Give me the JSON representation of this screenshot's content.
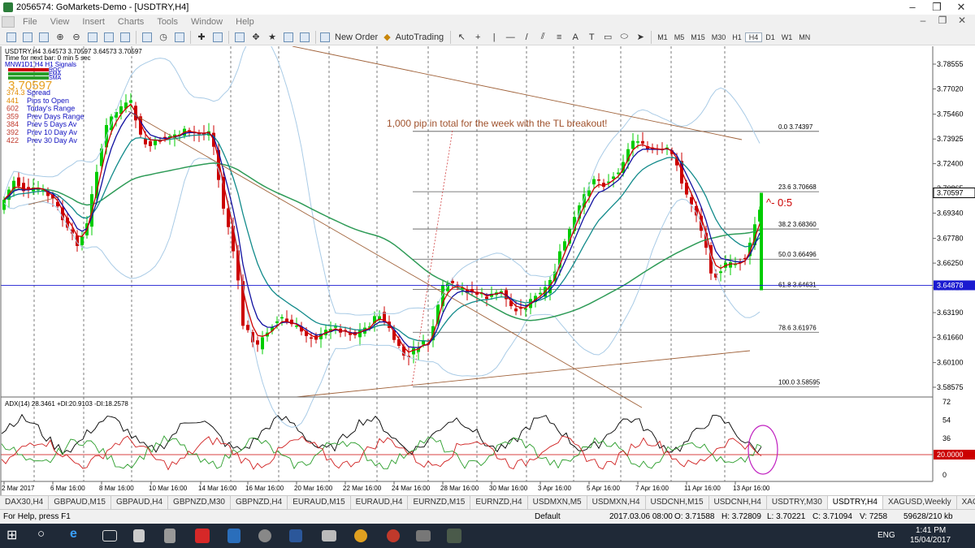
{
  "window": {
    "title": "2056574: GoMarkets-Demo - [USDTRY,H4]"
  },
  "menu": [
    "File",
    "View",
    "Insert",
    "Charts",
    "Tools",
    "Window",
    "Help"
  ],
  "toolbar": {
    "new_order": "New Order",
    "autotrading": "AutoTrading",
    "timeframes": [
      "M1",
      "M5",
      "M15",
      "M30",
      "H1",
      "H4",
      "D1",
      "W1",
      "MN"
    ],
    "active_tf": "H4"
  },
  "chart": {
    "header": "USDTRY,H4  3.64573 3.70597 3.64573 3.70597",
    "info_line1": "Time for next bar: 0 min 5 sec",
    "info_line2": "MNW1D1 H4 H1 Signals",
    "signal_labels": [
      "ROC",
      "EMA",
      "SMA"
    ],
    "big_price": "3.70597",
    "stats": [
      {
        "value": "374.3",
        "label": "Spread",
        "color": "#e08a00"
      },
      {
        "value": "441",
        "label": "Pips to Open",
        "color": "#e08a00"
      },
      {
        "value": "602",
        "label": "Today's Range",
        "color": "#c0392b"
      },
      {
        "value": "359",
        "label": "Prev Days Range",
        "color": "#c0392b"
      },
      {
        "value": "384",
        "label": "Prev 5 Days Av",
        "color": "#c0392b"
      },
      {
        "value": "392",
        "label": "Prev 10 Day Av",
        "color": "#c0392b"
      },
      {
        "value": "422",
        "label": "Prev 30 Day Av",
        "color": "#c0392b"
      }
    ],
    "annotation": "1,000 pip in total for the week with the TL breakout!",
    "ratio_label": "^- 0:5",
    "fib_levels": [
      {
        "label": "0.0  3.74397",
        "price": 3.74397
      },
      {
        "label": "23.6  3.70668",
        "price": 3.70668
      },
      {
        "label": "38.2  3.68360",
        "price": 3.6836
      },
      {
        "label": "50.0  3.66496",
        "price": 3.66496
      },
      {
        "label": "61.8  3.64631",
        "price": 3.64631
      },
      {
        "label": "78.6  3.61976",
        "price": 3.61976
      },
      {
        "label": "100.0  3.58595",
        "price": 3.58595
      }
    ],
    "price_axis": [
      "3.78555",
      "3.77020",
      "3.75460",
      "3.73925",
      "3.72400",
      "3.70865",
      "3.69340",
      "3.67780",
      "3.66250",
      "3.64715",
      "3.63190",
      "3.61660",
      "3.60100",
      "3.58575"
    ],
    "current_price": "3.70597",
    "hline_price": "3.64878",
    "time_axis": [
      "2 Mar 2017",
      "6 Mar 16:00",
      "8 Mar 16:00",
      "10 Mar 16:00",
      "14 Mar 16:00",
      "16 Mar 16:00",
      "20 Mar 16:00",
      "22 Mar 16:00",
      "24 Mar 16:00",
      "28 Mar 16:00",
      "30 Mar 16:00",
      "3 Apr 16:00",
      "5 Apr 16:00",
      "7 Apr 16:00",
      "11 Apr 16:00",
      "13 Apr 16:00"
    ],
    "adx_header": "ADX(14) 28.3461 +DI:20.9103 -DI:18.2578",
    "adx_axis": [
      "72",
      "54",
      "36",
      "20.0000",
      "0"
    ]
  },
  "tabs": [
    "DAX30,H4",
    "GBPAUD,M15",
    "GBPAUD,H4",
    "GBPNZD,M30",
    "GBPNZD,H4",
    "EURAUD,M15",
    "EURAUD,H4",
    "EURNZD,M15",
    "EURNZD,H4",
    "USDMXN,M5",
    "USDMXN,H4",
    "USDCNH,M15",
    "USDCNH,H4",
    "USDTRY,M30",
    "USDTRY,H4",
    "XAGUSD,Weekly",
    "XAGUSD"
  ],
  "active_tab": "USDTRY,H4",
  "status": {
    "help": "For Help, press F1",
    "profile": "Default",
    "time": "2017.03.06 08:00",
    "open": "O: 3.71588",
    "high": "H: 3.72809",
    "low": "L: 3.70221",
    "close": "C: 3.71094",
    "volume": "V: 7258",
    "traffic": "59628/210 kb"
  },
  "taskbar": {
    "lang": "ENG",
    "time": "1:41 PM",
    "date": "15/04/2017"
  },
  "colors": {
    "up": "#00cc00",
    "down": "#cc0000",
    "ma_fast": "#cc0000",
    "ma_mid": "#1010a0",
    "ma_slow": "#118a8a",
    "ma_long": "#2e9b57",
    "bands": "#a9cbe6",
    "trend": "#a0623a"
  }
}
